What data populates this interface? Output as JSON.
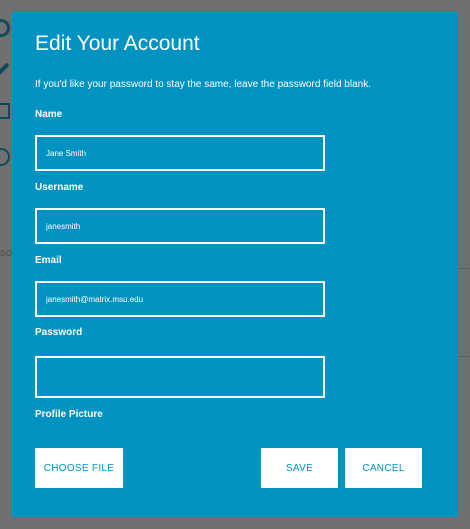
{
  "modal": {
    "title": "Edit Your Account",
    "description": "If you'd like your password to stay the same, leave the password field blank.",
    "fields": {
      "name": {
        "label": "Name",
        "value": "Jane Smith"
      },
      "username": {
        "label": "Username",
        "value": "janesmith"
      },
      "email": {
        "label": "Email",
        "value": "janesmith@matrix.msu.edu"
      },
      "password": {
        "label": "Password",
        "value": ""
      },
      "profile_picture": {
        "label": "Profile Picture"
      }
    },
    "buttons": {
      "choose_file": "CHOOSE FILE",
      "save": "SAVE",
      "cancel": "CANCEL"
    }
  },
  "background": {
    "partial_text": "SOU"
  },
  "colors": {
    "modal_bg": "#0093c1",
    "overlay": "#6f6f6f",
    "button_bg": "#ffffff",
    "button_text": "#0093c1"
  }
}
